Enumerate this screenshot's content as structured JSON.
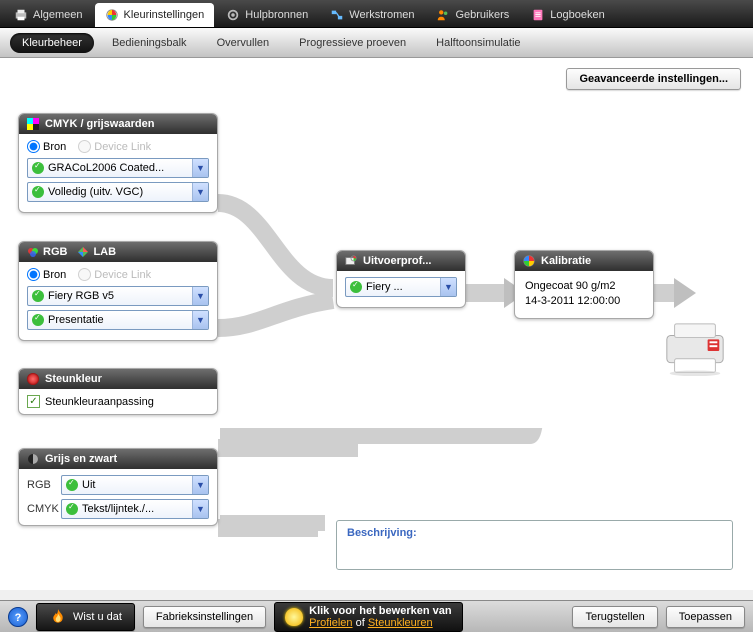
{
  "topTabs": {
    "t0": "Algemeen",
    "t1": "Kleurinstellingen",
    "t2": "Hulpbronnen",
    "t3": "Werkstromen",
    "t4": "Gebruikers",
    "t5": "Logboeken"
  },
  "subTabs": {
    "s0": "Kleurbeheer",
    "s1": "Bedieningsbalk",
    "s2": "Overvullen",
    "s3": "Progressieve proeven",
    "s4": "Halftoonsimulatie"
  },
  "advanced": "Geavanceerde instellingen...",
  "panels": {
    "cmyk": {
      "title": "CMYK / grijswaarden",
      "radioSource": "Bron",
      "radioDevice": "Device Link",
      "combo1": "GRACoL2006 Coated...",
      "combo2": "Volledig (uitv. VGC)"
    },
    "rgb": {
      "title1": "RGB",
      "title2": "LAB",
      "radioSource": "Bron",
      "radioDevice": "Device Link",
      "combo1": "Fiery RGB v5",
      "combo2": "Presentatie"
    },
    "spot": {
      "title": "Steunkleur",
      "chk": "Steunkleuraanpassing"
    },
    "gray": {
      "title": "Grijs en zwart",
      "rowRGB": "RGB",
      "rowCMYK": "CMYK",
      "combo1": "Uit",
      "combo2": "Tekst/lijntek./..."
    },
    "output": {
      "title": "Uitvoerprof...",
      "combo": "Fiery ..."
    },
    "calib": {
      "title": "Kalibratie",
      "line1": "Ongecoat 90 g/m2",
      "line2": "14-3-2011 12:00:00"
    }
  },
  "descLabel": "Beschrijving:",
  "bottom": {
    "didyou": "Wist u dat",
    "factory": "Fabrieksinstellingen",
    "hint1": "Klik voor het bewerken van",
    "hintLink1": "Profielen",
    "hintOf": " of ",
    "hintLink2": "Steunkleuren",
    "reset": "Terugstellen",
    "apply": "Toepassen"
  }
}
